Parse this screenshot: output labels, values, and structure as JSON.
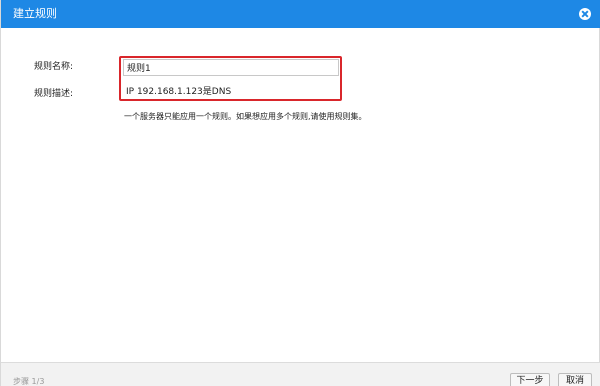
{
  "dialog": {
    "title": "建立规则"
  },
  "form": {
    "name_label": "规则名称:",
    "name_value": "规则1",
    "desc_label": "规则描述:",
    "desc_value": "IP 192.168.1.123是DNS",
    "hint": "一个服务器只能应用一个规则。如果想应用多个规则,请使用规则集。"
  },
  "footer": {
    "step": "步骤 1/3",
    "next_label": "下一步",
    "cancel_label": "取消"
  },
  "colors": {
    "titlebar": "#1e88e5",
    "highlight": "#d9262b"
  },
  "icons": {
    "close": "close-circle-icon"
  }
}
